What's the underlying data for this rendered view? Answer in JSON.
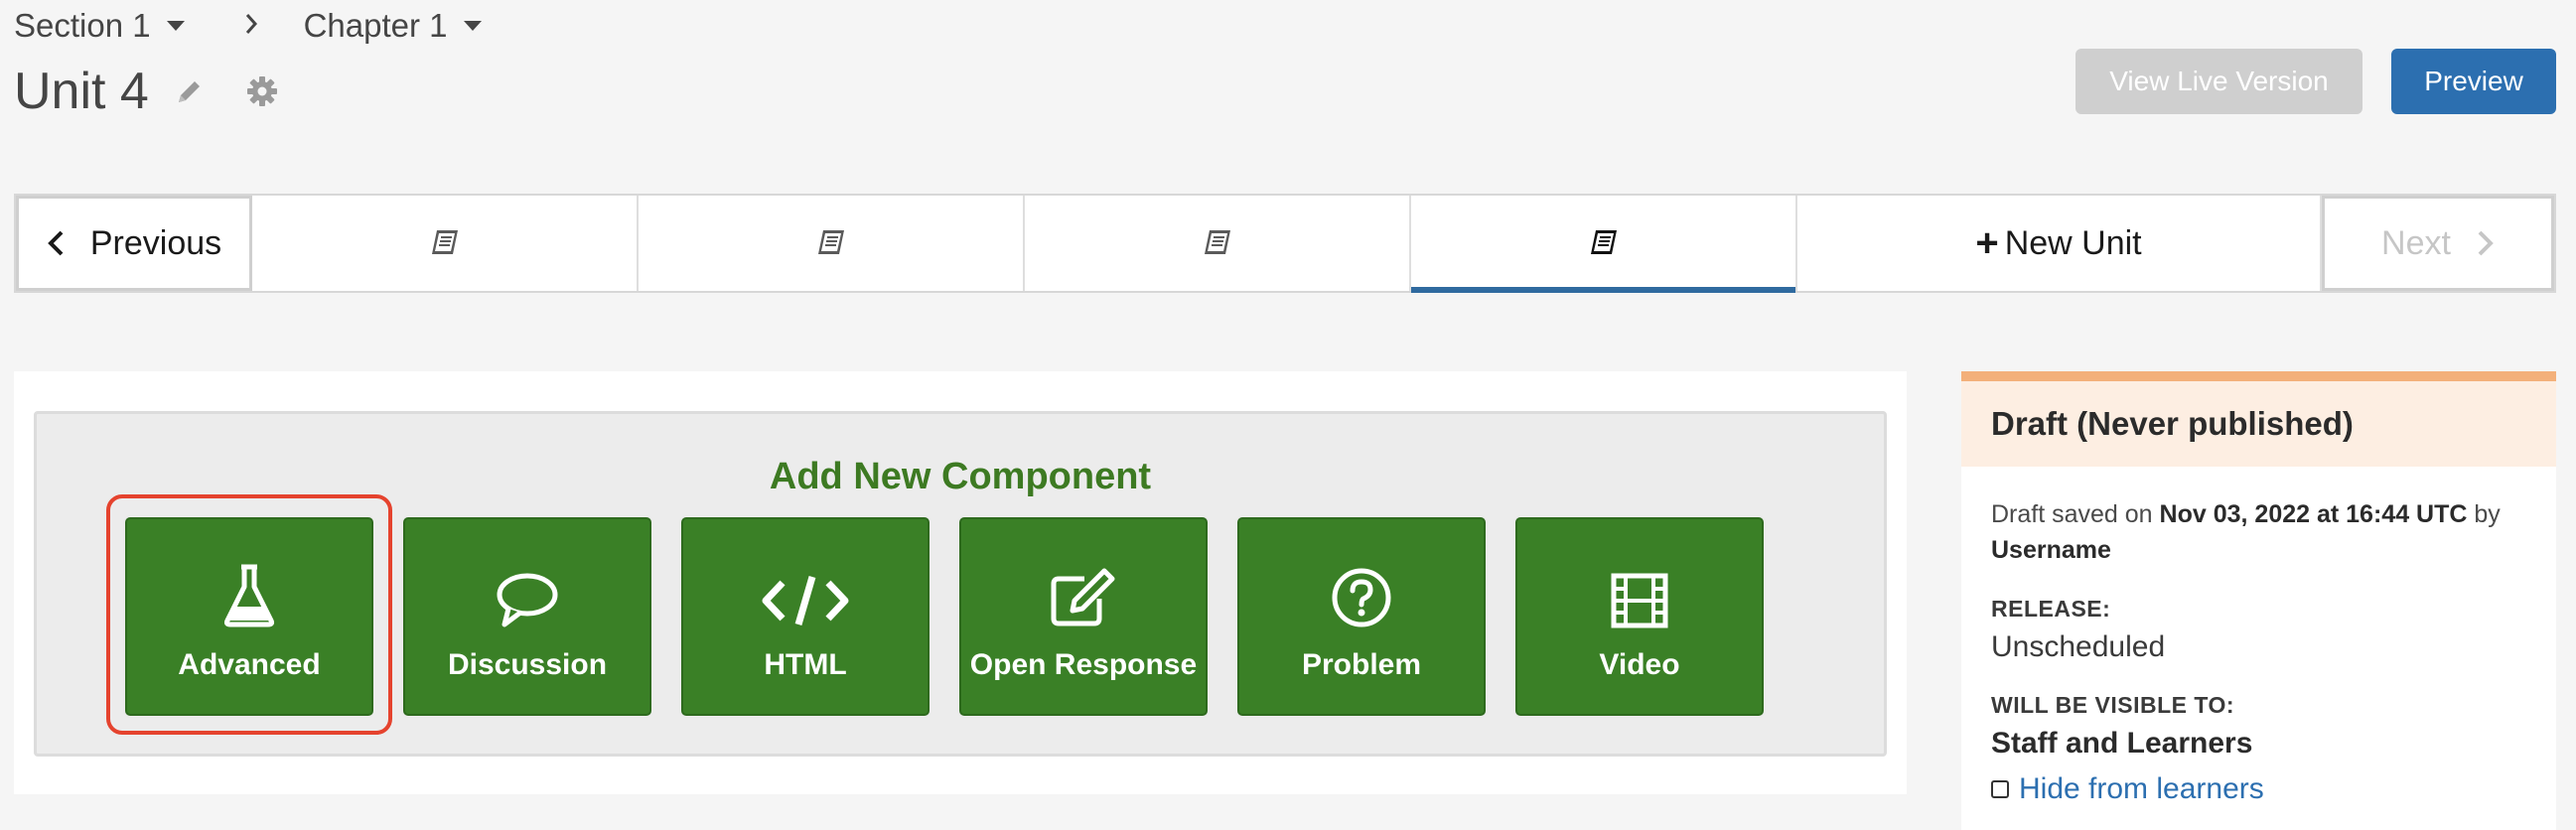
{
  "breadcrumb": {
    "section": "Section 1",
    "chapter": "Chapter 1"
  },
  "header": {
    "unit_title": "Unit 4",
    "view_live_label": "View Live Version",
    "preview_label": "Preview"
  },
  "unit_nav": {
    "previous_label": "Previous",
    "new_unit_label": "New Unit",
    "next_label": "Next",
    "units": [
      "book-icon",
      "book-icon",
      "book-icon",
      "book-icon"
    ],
    "active_index": 3
  },
  "add_component": {
    "title": "Add New Component",
    "buttons": [
      {
        "label": "Advanced",
        "icon": "flask-icon"
      },
      {
        "label": "Discussion",
        "icon": "speech-bubble-icon"
      },
      {
        "label": "HTML",
        "icon": "code-icon"
      },
      {
        "label": "Open Response",
        "icon": "edit-icon"
      },
      {
        "label": "Problem",
        "icon": "question-circle-icon"
      },
      {
        "label": "Video",
        "icon": "film-icon"
      }
    ]
  },
  "sidebar": {
    "status_title": "Draft (Never published)",
    "saved_prefix": "Draft saved on",
    "saved_date": "Nov 03, 2022 at 16:44 UTC",
    "saved_by": "by",
    "saved_user": "Username",
    "release_label": "RELEASE:",
    "release_value": "Unscheduled",
    "visible_label": "WILL BE VISIBLE TO:",
    "visible_value": "Staff and Learners",
    "hide_label": "Hide from learners"
  },
  "colors": {
    "component_green": "#3a8026",
    "primary_blue": "#2c6fb0",
    "highlight_red": "#e5432e",
    "draft_border": "#f3b07a"
  }
}
